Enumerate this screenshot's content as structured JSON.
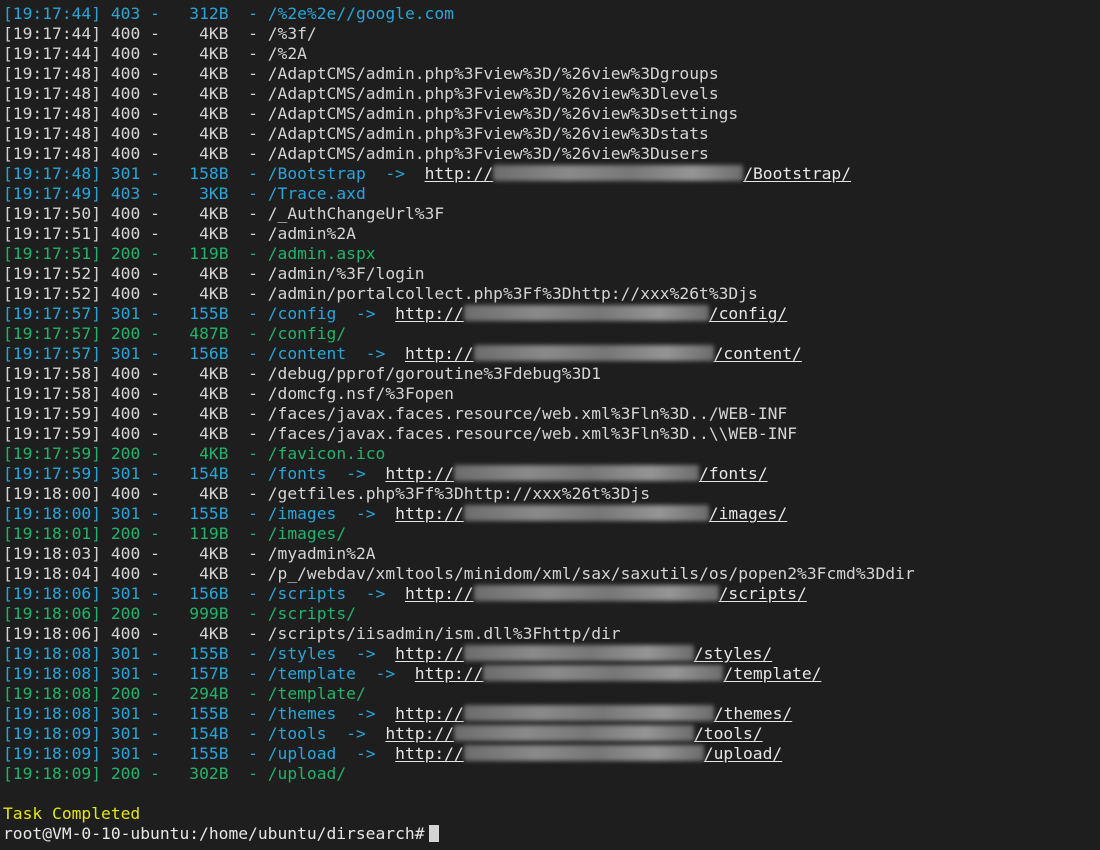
{
  "lines": [
    {
      "time": "[19:17:44]",
      "code": "403",
      "size": "312B",
      "path": "/%2e%2e//google.com",
      "color": "cyan"
    },
    {
      "time": "[19:17:44]",
      "code": "400",
      "size": "4KB",
      "path": "/%3f/",
      "color": "white"
    },
    {
      "time": "[19:17:44]",
      "code": "400",
      "size": "4KB",
      "path": "/%2A",
      "color": "white"
    },
    {
      "time": "[19:17:48]",
      "code": "400",
      "size": "4KB",
      "path": "/AdaptCMS/admin.php%3Fview%3D/%26view%3Dgroups",
      "color": "white"
    },
    {
      "time": "[19:17:48]",
      "code": "400",
      "size": "4KB",
      "path": "/AdaptCMS/admin.php%3Fview%3D/%26view%3Dlevels",
      "color": "white"
    },
    {
      "time": "[19:17:48]",
      "code": "400",
      "size": "4KB",
      "path": "/AdaptCMS/admin.php%3Fview%3D/%26view%3Dsettings",
      "color": "white"
    },
    {
      "time": "[19:17:48]",
      "code": "400",
      "size": "4KB",
      "path": "/AdaptCMS/admin.php%3Fview%3D/%26view%3Dstats",
      "color": "white"
    },
    {
      "time": "[19:17:48]",
      "code": "400",
      "size": "4KB",
      "path": "/AdaptCMS/admin.php%3Fview%3D/%26view%3Dusers",
      "color": "white"
    },
    {
      "time": "[19:17:48]",
      "code": "301",
      "size": "158B",
      "path": "/Bootstrap",
      "color": "cyan",
      "redirect_prefix": "http://",
      "redirect_suffix": "/Bootstrap/"
    },
    {
      "time": "[19:17:49]",
      "code": "403",
      "size": "3KB",
      "path": "/Trace.axd",
      "color": "cyan"
    },
    {
      "time": "[19:17:50]",
      "code": "400",
      "size": "4KB",
      "path": "/_AuthChangeUrl%3F",
      "color": "white"
    },
    {
      "time": "[19:17:51]",
      "code": "400",
      "size": "4KB",
      "path": "/admin%2A",
      "color": "white"
    },
    {
      "time": "[19:17:51]",
      "code": "200",
      "size": "119B",
      "path": "/admin.aspx",
      "color": "green"
    },
    {
      "time": "[19:17:52]",
      "code": "400",
      "size": "4KB",
      "path": "/admin/%3F/login",
      "color": "white"
    },
    {
      "time": "[19:17:52]",
      "code": "400",
      "size": "4KB",
      "path": "/admin/portalcollect.php%3Ff%3Dhttp://xxx%26t%3Djs",
      "color": "white"
    },
    {
      "time": "[19:17:57]",
      "code": "301",
      "size": "155B",
      "path": "/config",
      "color": "cyan",
      "redirect_prefix": "http://",
      "redirect_suffix": "/config/"
    },
    {
      "time": "[19:17:57]",
      "code": "200",
      "size": "487B",
      "path": "/config/",
      "color": "green"
    },
    {
      "time": "[19:17:57]",
      "code": "301",
      "size": "156B",
      "path": "/content",
      "color": "cyan",
      "redirect_prefix": "http://",
      "redirect_suffix": "/content/"
    },
    {
      "time": "[19:17:58]",
      "code": "400",
      "size": "4KB",
      "path": "/debug/pprof/goroutine%3Fdebug%3D1",
      "color": "white"
    },
    {
      "time": "[19:17:58]",
      "code": "400",
      "size": "4KB",
      "path": "/domcfg.nsf/%3Fopen",
      "color": "white"
    },
    {
      "time": "[19:17:59]",
      "code": "400",
      "size": "4KB",
      "path": "/faces/javax.faces.resource/web.xml%3Fln%3D../WEB-INF",
      "color": "white"
    },
    {
      "time": "[19:17:59]",
      "code": "400",
      "size": "4KB",
      "path": "/faces/javax.faces.resource/web.xml%3Fln%3D..\\\\WEB-INF",
      "color": "white"
    },
    {
      "time": "[19:17:59]",
      "code": "200",
      "size": "4KB",
      "path": "/favicon.ico",
      "color": "green"
    },
    {
      "time": "[19:17:59]",
      "code": "301",
      "size": "154B",
      "path": "/fonts",
      "color": "cyan",
      "redirect_prefix": "http://",
      "redirect_suffix": "/fonts/"
    },
    {
      "time": "[19:18:00]",
      "code": "400",
      "size": "4KB",
      "path": "/getfiles.php%3Ff%3Dhttp://xxx%26t%3Djs",
      "color": "white"
    },
    {
      "time": "[19:18:00]",
      "code": "301",
      "size": "155B",
      "path": "/images",
      "color": "cyan",
      "redirect_prefix": "http://",
      "redirect_suffix": "/images/"
    },
    {
      "time": "[19:18:01]",
      "code": "200",
      "size": "119B",
      "path": "/images/",
      "color": "green"
    },
    {
      "time": "[19:18:03]",
      "code": "400",
      "size": "4KB",
      "path": "/myadmin%2A",
      "color": "white"
    },
    {
      "time": "[19:18:04]",
      "code": "400",
      "size": "4KB",
      "path": "/p_/webdav/xmltools/minidom/xml/sax/saxutils/os/popen2%3Fcmd%3Ddir",
      "color": "white"
    },
    {
      "time": "[19:18:06]",
      "code": "301",
      "size": "156B",
      "path": "/scripts",
      "color": "cyan",
      "redirect_prefix": "http://",
      "redirect_suffix": "/scripts/"
    },
    {
      "time": "[19:18:06]",
      "code": "200",
      "size": "999B",
      "path": "/scripts/",
      "color": "green"
    },
    {
      "time": "[19:18:06]",
      "code": "400",
      "size": "4KB",
      "path": "/scripts/iisadmin/ism.dll%3Fhttp/dir",
      "color": "white"
    },
    {
      "time": "[19:18:08]",
      "code": "301",
      "size": "155B",
      "path": "/styles",
      "color": "cyan",
      "redirect_prefix": "http://",
      "redirect_suffix": "/styles/"
    },
    {
      "time": "[19:18:08]",
      "code": "301",
      "size": "157B",
      "path": "/template",
      "color": "cyan",
      "redirect_prefix": "http://",
      "redirect_suffix": "/template/"
    },
    {
      "time": "[19:18:08]",
      "code": "200",
      "size": "294B",
      "path": "/template/",
      "color": "green"
    },
    {
      "time": "[19:18:08]",
      "code": "301",
      "size": "155B",
      "path": "/themes",
      "color": "cyan",
      "redirect_prefix": "http://",
      "redirect_suffix": "/themes/"
    },
    {
      "time": "[19:18:09]",
      "code": "301",
      "size": "154B",
      "path": "/tools",
      "color": "cyan",
      "redirect_prefix": "http://",
      "redirect_suffix": "/tools/"
    },
    {
      "time": "[19:18:09]",
      "code": "301",
      "size": "155B",
      "path": "/upload",
      "color": "cyan",
      "redirect_prefix": "http://",
      "redirect_suffix": "/upload/"
    },
    {
      "time": "[19:18:09]",
      "code": "200",
      "size": "302B",
      "path": "/upload/",
      "color": "green"
    }
  ],
  "status_message": "Task Completed",
  "prompt": "root@VM-0-10-ubuntu:/home/ubuntu/dirsearch#",
  "colors": {
    "background": "#1e1e1e",
    "default_text": "#d4d4d4",
    "cyan": "#2aa5d9",
    "green": "#23b36a",
    "yellow": "#e5e510"
  }
}
